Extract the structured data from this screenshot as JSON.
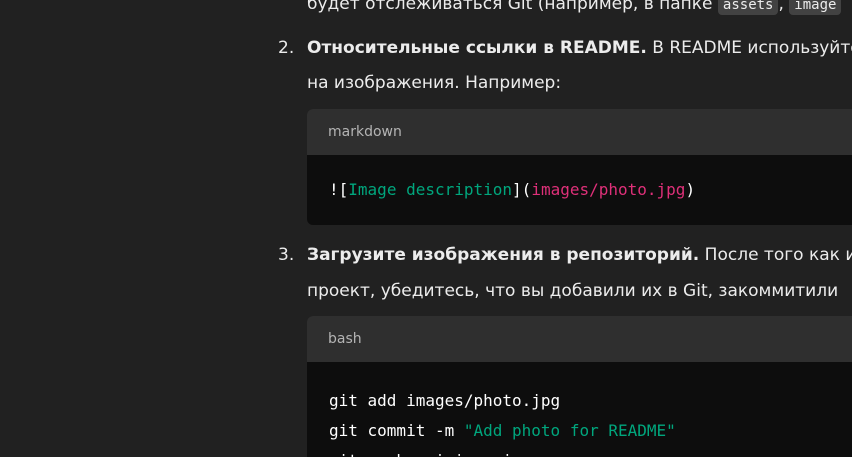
{
  "item1": {
    "tail_text": "будет отслеживаться Git (например, в папке ",
    "code1": "assets",
    "sep": ",",
    "code2": "image"
  },
  "item2": {
    "number": "2.",
    "bold": "Относительные ссылки в README.",
    "text": " В README используйте",
    "line2": "на изображения. Например:",
    "code_lang": "markdown",
    "code": {
      "bang": "!",
      "open_bracket": "[",
      "alt": "Image description",
      "mid": "](",
      "path": "images/photo.jpg",
      "close": ")"
    }
  },
  "item3": {
    "number": "3.",
    "bold": "Загрузите изображения в репозиторий.",
    "text": " После того как из",
    "line2": "проект, убедитесь, что вы добавили их в Git, закоммитили",
    "code_lang": "bash",
    "code": {
      "line1": "git add images/photo.jpg",
      "line2_cmd": "git commit -m ",
      "line2_str": "\"Add photo for README\"",
      "line3": "git push origin main"
    }
  }
}
